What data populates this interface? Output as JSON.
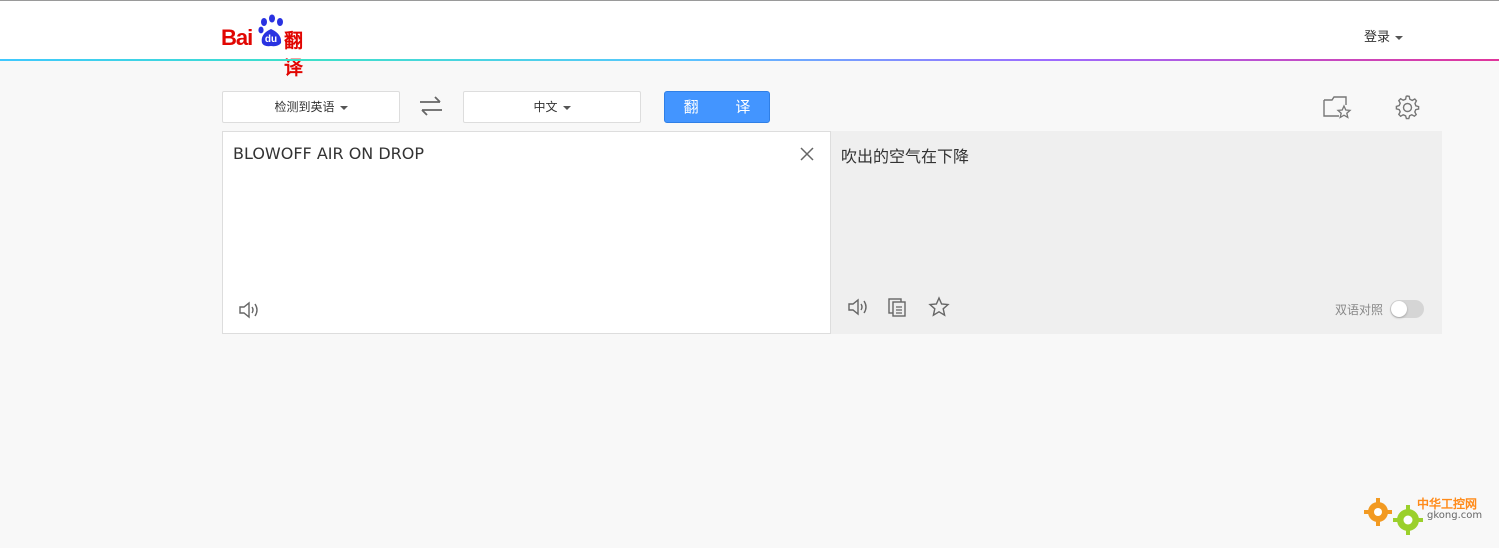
{
  "header": {
    "logo_bai": "Bai",
    "logo_du": "du",
    "logo_fanyi": "翻译",
    "login_label": "登录"
  },
  "toolbar": {
    "source_language": "检测到英语",
    "target_language": "中文",
    "translate_button": "翻 译"
  },
  "input": {
    "text": "BLOWOFF AIR ON DROP"
  },
  "output": {
    "text": "吹出的空气在下降",
    "bilingual_label": "双语对照",
    "bilingual_enabled": false
  },
  "watermark": {
    "name_cn": "中华工控网",
    "domain": "gkong.com"
  },
  "icons": {
    "swap": "swap-icon",
    "favorites": "folder-star-icon",
    "settings": "gear-icon",
    "clear": "close-icon",
    "speaker": "speaker-icon",
    "copy": "copy-icon",
    "star": "star-icon"
  },
  "colors": {
    "brand_red": "#e10602",
    "brand_blue": "#2932e1",
    "button_blue": "#4395ff",
    "watermark_orange": "#ff8b1a"
  }
}
